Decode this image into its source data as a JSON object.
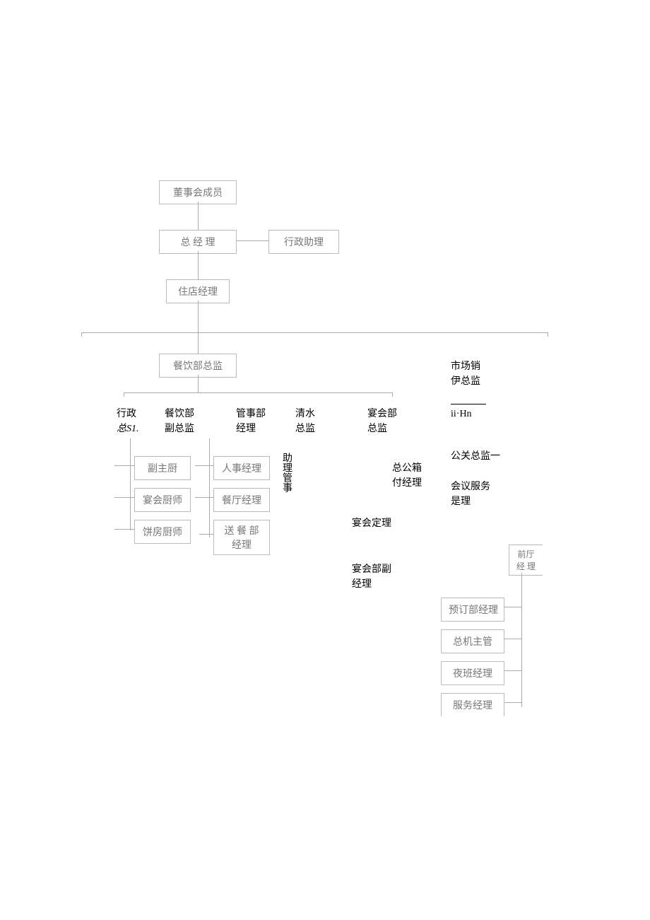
{
  "top": {
    "board": "董事会成员",
    "gm": "总 经 理",
    "assistant": "行政助理",
    "resident": "住店经理"
  },
  "fb_dir": "餐饮部总监",
  "row1": {
    "c1a": "行政",
    "c1b": "总S1.",
    "c2a": "餐饮部",
    "c2b": "副总监",
    "c3a": "管事部",
    "c3b": "经理",
    "c4a": "清水",
    "c4b": "总监",
    "c5a": "宴会部",
    "c5b": "总监",
    "r_a": "市场销",
    "r_b": "伊总监",
    "r_c": "ii·Hn"
  },
  "leftcol": {
    "a": "副主厨",
    "b": "宴会厨师",
    "c": "饼房厨师"
  },
  "midcol": {
    "a": "人事经理",
    "b": "餐厅经理",
    "c1": "送 餐 部",
    "c2": "经理"
  },
  "asst_steward": "助理管事",
  "right_text": {
    "t1a": "总公箱",
    "t1b": "付经理",
    "t2": "宴会定理",
    "t3a": "宴会部副",
    "t3b": "经理",
    "pr": "公关总监一",
    "mtg_a": "会议服务",
    "mtg_b": "是理"
  },
  "front": {
    "hdr1": "前厅",
    "hdr2": "经 理",
    "a": "预订部经理",
    "b": "总机主管",
    "c": "夜班经理",
    "d": "服务经理"
  }
}
